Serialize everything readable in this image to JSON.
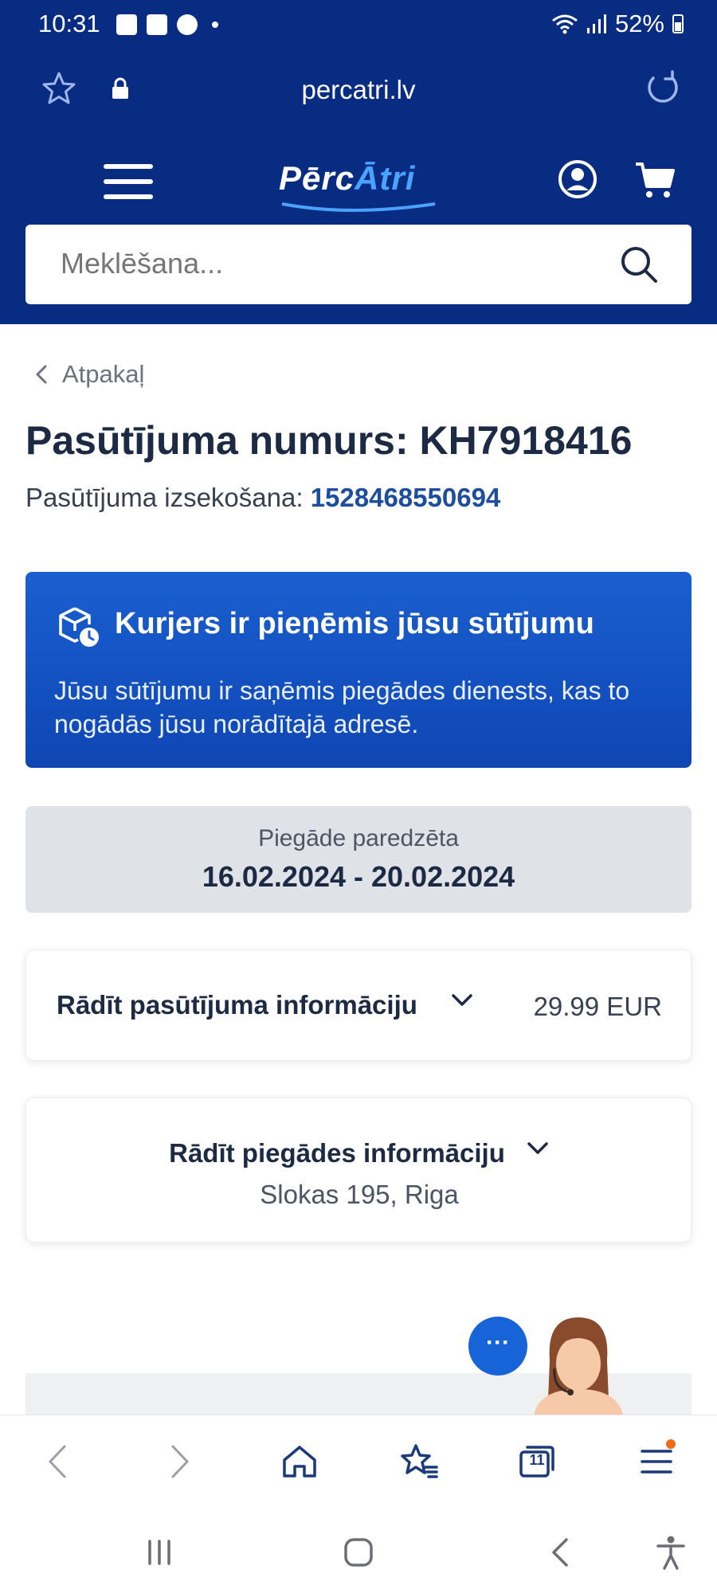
{
  "status_bar": {
    "time": "10:31",
    "battery": "52%"
  },
  "browser": {
    "url": "percatri.lv",
    "tabs_count": "11"
  },
  "site": {
    "logo_part1": "Pērc",
    "logo_part2": "Ātri",
    "search_placeholder": "Meklēšana..."
  },
  "order": {
    "back_label": "Atpakaļ",
    "title": "Pasūtījuma numurs: KH7918416",
    "tracking_label": "Pasūtījuma izsekošana:",
    "tracking_number": "1528468550694",
    "status_title": "Kurjers ir pieņēmis jūsu sūtījumu",
    "status_desc": "Jūsu sūtījumu ir saņēmis piegādes dienests, kas to nogādās jūsu norādītajā adresē.",
    "delivery_label": "Piegāde paredzēta",
    "delivery_dates": "16.02.2024 - 20.02.2024",
    "order_info_label": "Rādīt pasūtījuma informāciju",
    "order_total": "29.99 EUR",
    "shipping_info_label": "Rādīt piegādes informāciju",
    "shipping_address": "Slokas 195, Riga"
  },
  "chat": {
    "bubble": "···"
  },
  "colors": {
    "header_bg": "#082c82",
    "status_card": "#1a5fd0",
    "link": "#1d4e9e",
    "notify_dot": "#f06a1a"
  }
}
